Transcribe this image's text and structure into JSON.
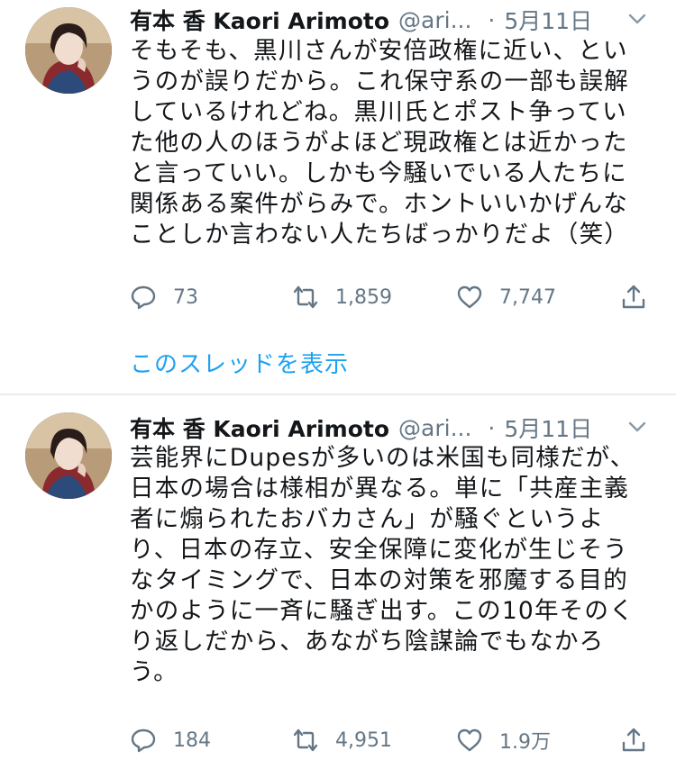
{
  "tweets": [
    {
      "author_name": "有本 香 Kaori Arimoto",
      "handle": "@ari...",
      "separator": "·",
      "date": "5月11日",
      "lines": [
        "そもそも、黒川さんが安倍政権に近い、とい",
        "うのが誤りだから。これ保守系の一部も誤解",
        "しているけれどね。黒川氏とポスト争ってい",
        "た他の人のほうがよほど現政権とは近かった",
        "と言っていい。しかも今騒いでいる人たちに",
        "関係ある案件がらみで。ホントいいかげんな",
        "ことしか言わない人たちばっかりだよ（笑）"
      ],
      "replies": "73",
      "retweets": "1,859",
      "likes": "7,747",
      "thread_link": "このスレッドを表示"
    },
    {
      "author_name": "有本 香 Kaori Arimoto",
      "handle": "@ari...",
      "separator": "·",
      "date": "5月11日",
      "lines": [
        "芸能界にDupesが多いのは米国も同様だが、",
        "日本の場合は様相が異なる。単に「共産主義",
        "者に煽られたおバカさん」が騒ぐというよ",
        "り、日本の存立、安全保障に変化が生じそう",
        "なタイミングで、日本の対策を邪魔する目的",
        "かのように一斉に騒ぎ出す。この10年そのく",
        "り返しだから、あながち陰謀論でもなかろ",
        "う。"
      ],
      "replies": "184",
      "retweets": "4,951",
      "likes": "1.9万"
    }
  ],
  "icons": [
    "avatar",
    "chevron-down-icon",
    "reply-icon",
    "retweet-icon",
    "like-icon",
    "share-icon"
  ],
  "colors": {
    "text": "#14171a",
    "muted": "#657786",
    "link": "#1da1f2",
    "divider": "#e6ecf0"
  }
}
